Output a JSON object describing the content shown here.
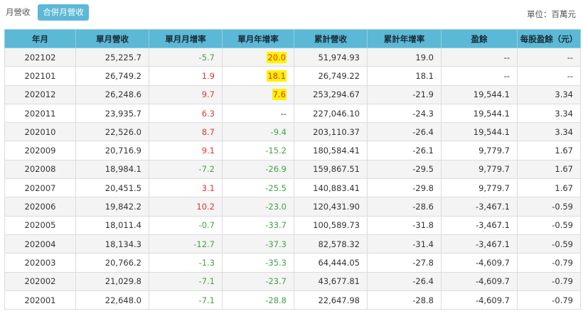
{
  "tabs": {
    "monthly": "月營收",
    "consolidated": "合併月營收"
  },
  "unit": "單位：百萬元",
  "colors": {
    "header_bg": "#5bb8d6",
    "positive": "#e53333",
    "negative": "#45a045",
    "highlight": "#fff200"
  },
  "columns": [
    "年月",
    "單月營收",
    "單月月增率",
    "單月年增率",
    "累計營收",
    "累計年增率",
    "盈餘",
    "每股盈餘（元）"
  ],
  "rows": [
    {
      "ym": "202102",
      "rev": "25,225.7",
      "mom": "-5.7",
      "yoy": "20.0",
      "yoy_hl": true,
      "cum": "51,974.93",
      "cum_yoy": "19.0",
      "earn": "--",
      "eps": "--"
    },
    {
      "ym": "202101",
      "rev": "26,749.2",
      "mom": "1.9",
      "yoy": "18.1",
      "yoy_hl": true,
      "cum": "26,749.22",
      "cum_yoy": "18.1",
      "earn": "--",
      "eps": "--"
    },
    {
      "ym": "202012",
      "rev": "26,248.6",
      "mom": "9.7",
      "yoy": "7.6",
      "yoy_hl": true,
      "cum": "253,294.67",
      "cum_yoy": "-21.9",
      "earn": "19,544.1",
      "eps": "3.34"
    },
    {
      "ym": "202011",
      "rev": "23,935.7",
      "mom": "6.3",
      "yoy": "--",
      "yoy_hl": false,
      "cum": "227,046.10",
      "cum_yoy": "-24.3",
      "earn": "19,544.1",
      "eps": "3.34"
    },
    {
      "ym": "202010",
      "rev": "22,526.0",
      "mom": "8.7",
      "yoy": "-9.4",
      "yoy_hl": false,
      "cum": "203,110.37",
      "cum_yoy": "-26.4",
      "earn": "19,544.1",
      "eps": "3.34"
    },
    {
      "ym": "202009",
      "rev": "20,716.9",
      "mom": "9.1",
      "yoy": "-15.2",
      "yoy_hl": false,
      "cum": "180,584.41",
      "cum_yoy": "-26.1",
      "earn": "9,779.7",
      "eps": "1.67"
    },
    {
      "ym": "202008",
      "rev": "18,984.1",
      "mom": "-7.2",
      "yoy": "-26.9",
      "yoy_hl": false,
      "cum": "159,867.51",
      "cum_yoy": "-29.5",
      "earn": "9,779.7",
      "eps": "1.67"
    },
    {
      "ym": "202007",
      "rev": "20,451.5",
      "mom": "3.1",
      "yoy": "-25.5",
      "yoy_hl": false,
      "cum": "140,883.41",
      "cum_yoy": "-29.8",
      "earn": "9,779.7",
      "eps": "1.67"
    },
    {
      "ym": "202006",
      "rev": "19,842.2",
      "mom": "10.2",
      "yoy": "-23.0",
      "yoy_hl": false,
      "cum": "120,431.90",
      "cum_yoy": "-28.6",
      "earn": "-3,467.1",
      "eps": "-0.59"
    },
    {
      "ym": "202005",
      "rev": "18,011.4",
      "mom": "-0.7",
      "yoy": "-33.7",
      "yoy_hl": false,
      "cum": "100,589.73",
      "cum_yoy": "-31.8",
      "earn": "-3,467.1",
      "eps": "-0.59"
    },
    {
      "ym": "202004",
      "rev": "18,134.3",
      "mom": "-12.7",
      "yoy": "-37.3",
      "yoy_hl": false,
      "cum": "82,578.32",
      "cum_yoy": "-31.4",
      "earn": "-3,467.1",
      "eps": "-0.59"
    },
    {
      "ym": "202003",
      "rev": "20,766.2",
      "mom": "-1.3",
      "yoy": "-35.3",
      "yoy_hl": false,
      "cum": "64,444.05",
      "cum_yoy": "-27.8",
      "earn": "-4,609.7",
      "eps": "-0.79"
    },
    {
      "ym": "202002",
      "rev": "21,029.8",
      "mom": "-7.1",
      "yoy": "-23.7",
      "yoy_hl": false,
      "cum": "43,677.81",
      "cum_yoy": "-26.4",
      "earn": "-4,609.7",
      "eps": "-0.79"
    },
    {
      "ym": "202001",
      "rev": "22,648.0",
      "mom": "-7.1",
      "yoy": "-28.8",
      "yoy_hl": false,
      "cum": "22,647.98",
      "cum_yoy": "-28.8",
      "earn": "-4,609.7",
      "eps": "-0.79"
    }
  ]
}
